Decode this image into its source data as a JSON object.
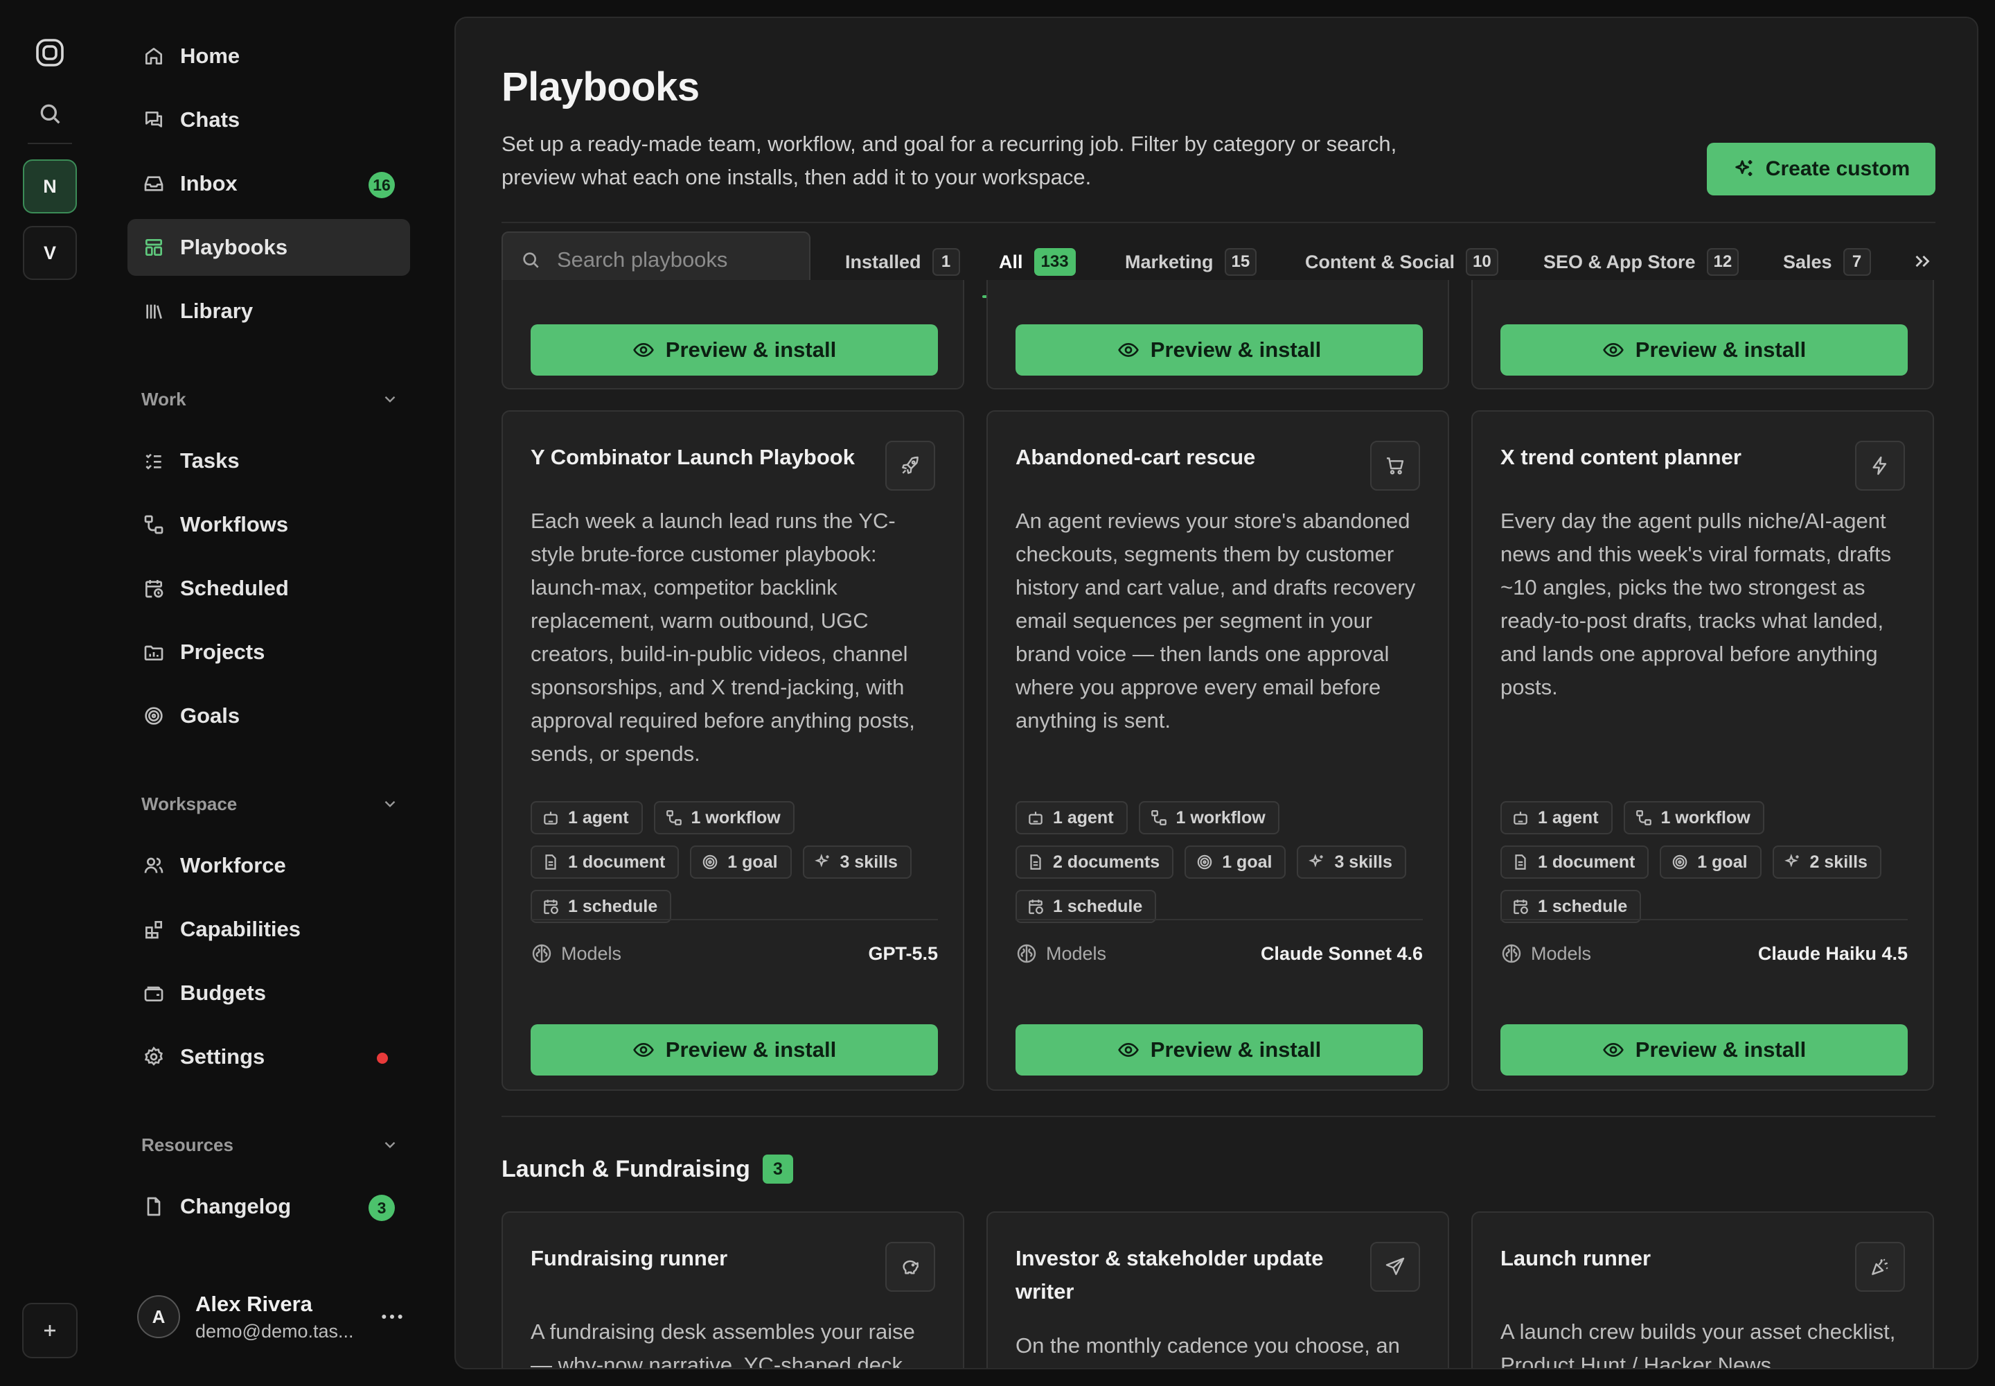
{
  "rail": {
    "workspaces": [
      "N",
      "V"
    ]
  },
  "sidebar": {
    "top_items": [
      {
        "label": "Home",
        "icon": "home-icon"
      },
      {
        "label": "Chats",
        "icon": "chat-icon"
      },
      {
        "label": "Inbox",
        "icon": "inbox-icon",
        "badge": "16"
      },
      {
        "label": "Playbooks",
        "icon": "playbooks-icon",
        "active": true
      },
      {
        "label": "Library",
        "icon": "library-icon"
      }
    ],
    "work": {
      "title": "Work",
      "items": [
        {
          "label": "Tasks",
          "icon": "tasks-icon"
        },
        {
          "label": "Workflows",
          "icon": "workflow-icon"
        },
        {
          "label": "Scheduled",
          "icon": "calendar-clock-icon"
        },
        {
          "label": "Projects",
          "icon": "projects-icon"
        },
        {
          "label": "Goals",
          "icon": "target-icon"
        }
      ]
    },
    "workspace": {
      "title": "Workspace",
      "items": [
        {
          "label": "Workforce",
          "icon": "people-icon"
        },
        {
          "label": "Capabilities",
          "icon": "capabilities-icon"
        },
        {
          "label": "Budgets",
          "icon": "wallet-icon"
        },
        {
          "label": "Settings",
          "icon": "gear-icon",
          "dot_color": "#e83a3a"
        }
      ]
    },
    "resources": {
      "title": "Resources",
      "items": [
        {
          "label": "Changelog",
          "icon": "document-icon",
          "badge": "3"
        }
      ]
    },
    "profile": {
      "initial": "A",
      "name": "Alex Rivera",
      "email": "demo@demo.tas..."
    }
  },
  "header": {
    "title": "Playbooks",
    "description": "Set up a ready-made team, workflow, and goal for a recurring job. Filter by category or search, preview what each one installs, then add it to your workspace.",
    "create_label": "Create custom"
  },
  "search": {
    "placeholder": "Search playbooks"
  },
  "tabs": [
    {
      "label": "Installed",
      "count": "1"
    },
    {
      "label": "All",
      "count": "133",
      "active": true
    },
    {
      "label": "Marketing",
      "count": "15"
    },
    {
      "label": "Content & Social",
      "count": "10"
    },
    {
      "label": "SEO & App Store",
      "count": "12"
    },
    {
      "label": "Sales",
      "count": "7"
    }
  ],
  "preview_label": "Preview & install",
  "models_label": "Models",
  "cards": [
    {
      "title": "Y Combinator Launch Playbook",
      "icon": "rocket-icon",
      "description": "Each week a launch lead runs the YC-style brute-force customer playbook: launch-max, competitor backlink replacement, warm outbound, UGC creators, build-in-public videos, channel sponsorships, and X trend-jacking, with approval required before anything posts, sends, or spends.",
      "chips": [
        "1 agent",
        "1 workflow",
        "1 document",
        "1 goal",
        "3 skills",
        "1 schedule"
      ],
      "model": "GPT-5.5"
    },
    {
      "title": "Abandoned-cart rescue",
      "icon": "cart-icon",
      "description": "An agent reviews your store's abandoned checkouts, segments them by customer history and cart value, and drafts recovery email sequences per segment in your brand voice — then lands one approval where you approve every email before anything is sent.",
      "chips": [
        "1 agent",
        "1 workflow",
        "2 documents",
        "1 goal",
        "3 skills",
        "1 schedule"
      ],
      "model": "Claude Sonnet 4.6"
    },
    {
      "title": "X trend content planner",
      "icon": "lightning-icon",
      "description": "Every day the agent pulls niche/AI-agent news and this week's viral formats, drafts ~10 angles, picks the two strongest as ready-to-post drafts, tracks what landed, and lands one approval before anything posts.",
      "chips": [
        "1 agent",
        "1 workflow",
        "1 document",
        "1 goal",
        "2 skills",
        "1 schedule"
      ],
      "model": "Claude Haiku 4.5"
    }
  ],
  "section": {
    "title": "Launch & Fundraising",
    "count": "3",
    "cards": [
      {
        "title": "Fundraising runner",
        "icon": "piggy-bank-icon",
        "description": "A fundraising desk assembles your raise — why-now narrative, YC-shaped deck,"
      },
      {
        "title": "Investor & stakeholder update writer",
        "icon": "send-icon",
        "description": "On the monthly cadence you choose, an update writer turns your progress"
      },
      {
        "title": "Launch runner",
        "icon": "party-popper-icon",
        "description": "A launch crew builds your asset checklist, Product Hunt / Hacker News"
      }
    ]
  },
  "colors": {
    "accent": "#55c173",
    "background": "#0f0f0f",
    "panel": "#1c1c1c",
    "card": "#222222",
    "alert_dot": "#e83a3a"
  }
}
